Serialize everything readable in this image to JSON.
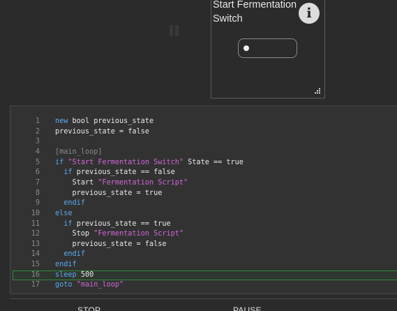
{
  "widget": {
    "title": "Start Fermentation Switch",
    "info_icon": "info-icon",
    "info_glyph": "i",
    "toggle_state": "off"
  },
  "editor": {
    "highlighted_line": 16,
    "lines": [
      {
        "num": "1",
        "tokens": [
          {
            "t": "new",
            "c": "kw"
          },
          {
            "t": " bool previous_state",
            "c": ""
          }
        ]
      },
      {
        "num": "2",
        "tokens": [
          {
            "t": "previous_state = false",
            "c": ""
          }
        ]
      },
      {
        "num": "3",
        "tokens": []
      },
      {
        "num": "4",
        "tokens": [
          {
            "t": "[main_loop]",
            "c": "cmt"
          }
        ]
      },
      {
        "num": "5",
        "tokens": [
          {
            "t": "if",
            "c": "kw"
          },
          {
            "t": " ",
            "c": ""
          },
          {
            "t": "\"Start Fermentation Switch\"",
            "c": "str"
          },
          {
            "t": " State == true",
            "c": ""
          }
        ]
      },
      {
        "num": "6",
        "tokens": [
          {
            "t": "  ",
            "c": ""
          },
          {
            "t": "if",
            "c": "kw"
          },
          {
            "t": " previous_state == false",
            "c": ""
          }
        ]
      },
      {
        "num": "7",
        "tokens": [
          {
            "t": "    Start ",
            "c": ""
          },
          {
            "t": "\"Fermentation Script\"",
            "c": "str"
          }
        ]
      },
      {
        "num": "8",
        "tokens": [
          {
            "t": "    previous_state = true",
            "c": ""
          }
        ]
      },
      {
        "num": "9",
        "tokens": [
          {
            "t": "  ",
            "c": ""
          },
          {
            "t": "endif",
            "c": "kw"
          }
        ]
      },
      {
        "num": "10",
        "tokens": [
          {
            "t": "else",
            "c": "kw"
          }
        ]
      },
      {
        "num": "11",
        "tokens": [
          {
            "t": "  ",
            "c": ""
          },
          {
            "t": "if",
            "c": "kw"
          },
          {
            "t": " previous_state == true",
            "c": ""
          }
        ]
      },
      {
        "num": "12",
        "tokens": [
          {
            "t": "    Stop ",
            "c": ""
          },
          {
            "t": "\"Fermentation Script\"",
            "c": "str"
          }
        ]
      },
      {
        "num": "13",
        "tokens": [
          {
            "t": "    previous_state = false",
            "c": ""
          }
        ]
      },
      {
        "num": "14",
        "tokens": [
          {
            "t": "  ",
            "c": ""
          },
          {
            "t": "endif",
            "c": "kw"
          }
        ]
      },
      {
        "num": "15",
        "tokens": [
          {
            "t": "endif",
            "c": "kw"
          }
        ]
      },
      {
        "num": "16",
        "tokens": [
          {
            "t": "sleep",
            "c": "kw"
          },
          {
            "t": " 500",
            "c": ""
          }
        ]
      },
      {
        "num": "17",
        "tokens": [
          {
            "t": "goto",
            "c": "kw"
          },
          {
            "t": " ",
            "c": ""
          },
          {
            "t": "\"main_loop\"",
            "c": "str"
          }
        ]
      }
    ]
  },
  "buttons": {
    "stop_label": "STOP",
    "pause_label": "PAUSE"
  },
  "colors": {
    "keyword": "#5aa9f0",
    "string": "#d066d6",
    "comment": "#8a8a8a",
    "highlight_border": "#2f8c3a"
  }
}
